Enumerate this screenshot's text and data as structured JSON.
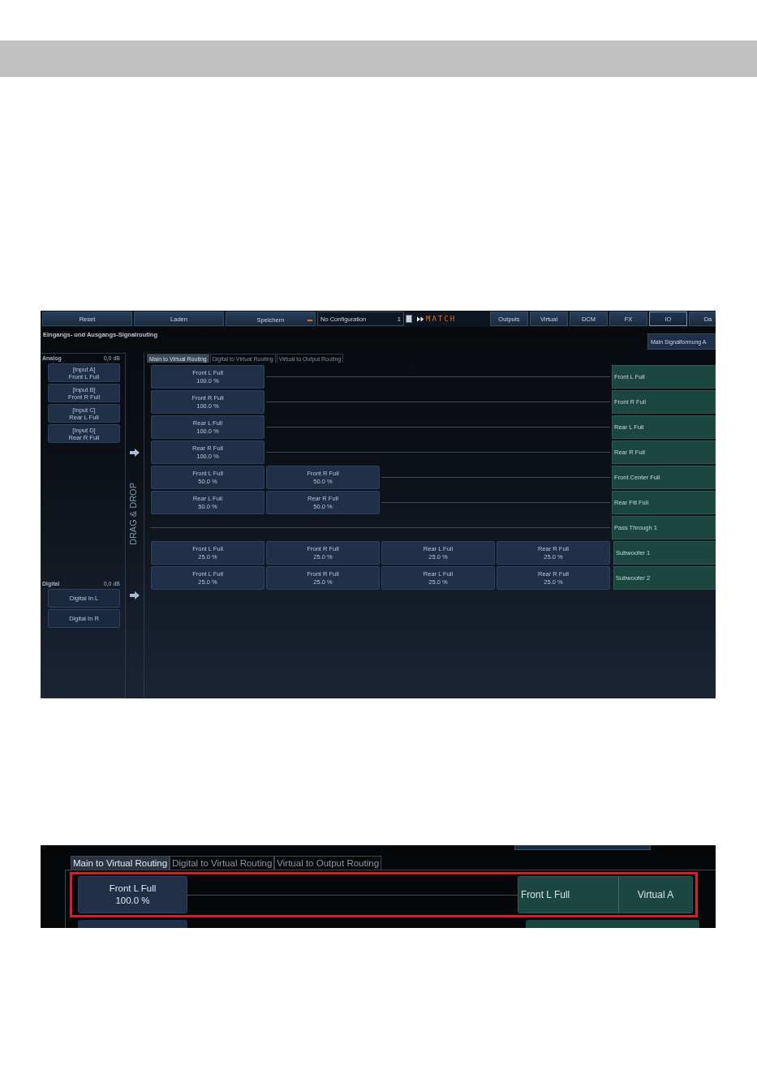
{
  "toolbar": {
    "buttons": [
      {
        "label": "Reset"
      },
      {
        "label": "Laden"
      }
    ],
    "save_dropdown": "Speichern",
    "configuration": "No Configuration",
    "configuration_index": "1",
    "logo": "MATCH",
    "nav_tabs": [
      {
        "label": "Outputs",
        "selected": false
      },
      {
        "label": "Virtual",
        "selected": false
      },
      {
        "label": "DCM",
        "selected": false
      },
      {
        "label": "FX",
        "selected": false
      },
      {
        "label": "IO",
        "selected": true
      },
      {
        "label": "Da",
        "selected": false
      }
    ]
  },
  "title": "Eingangs- und Ausgangs-Signalrouting",
  "side_button": "Main Signalformung A",
  "analog": {
    "title": "Analog",
    "gain": "0,0 dB",
    "inputs": [
      {
        "label": "[Input A]",
        "source": "Front L Full"
      },
      {
        "label": "[Input B]",
        "source": "Front R Full"
      },
      {
        "label": "[Input C]",
        "source": "Rear L Full"
      },
      {
        "label": "[Input D]",
        "source": "Rear R Full"
      }
    ]
  },
  "digital": {
    "title": "Digital",
    "gain": "0,0 dB",
    "inputs": [
      {
        "label": "Digital In L"
      },
      {
        "label": "Digital In R"
      }
    ]
  },
  "drag_hint": "DRAG & DROP",
  "routing_tabs": [
    {
      "label": "Main to Virtual Routing",
      "selected": true
    },
    {
      "label": "Digital to Virtual Routing",
      "selected": false
    },
    {
      "label": "Virtual to Output Routing",
      "selected": false
    }
  ],
  "routes": [
    {
      "sources": [
        {
          "name": "Front L Full",
          "share": "100.0 %"
        }
      ],
      "target": "Front L Full"
    },
    {
      "sources": [
        {
          "name": "Front R Full",
          "share": "100.0 %"
        }
      ],
      "target": "Front R Full"
    },
    {
      "sources": [
        {
          "name": "Rear L Full",
          "share": "100.0 %"
        }
      ],
      "target": "Rear L Full"
    },
    {
      "sources": [
        {
          "name": "Rear R Full",
          "share": "100.0 %"
        }
      ],
      "target": "Rear R Full"
    },
    {
      "sources": [
        {
          "name": "Front L Full",
          "share": "50.0 %"
        },
        {
          "name": "Front R Full",
          "share": "50.0 %"
        }
      ],
      "target": "Front Center Full"
    },
    {
      "sources": [
        {
          "name": "Rear L Full",
          "share": "50.0 %"
        },
        {
          "name": "Rear R Full",
          "share": "50.0 %"
        }
      ],
      "target": "Rear Fill Full"
    },
    {
      "target": "Pass Through 1"
    },
    {
      "sources": [
        {
          "name": "Front L Full",
          "share": "25.0 %"
        },
        {
          "name": "Front R Full",
          "share": "25.0 %"
        },
        {
          "name": "Rear L Full",
          "share": "25.0 %"
        },
        {
          "name": "Rear R Full",
          "share": "25.0 %"
        }
      ],
      "target": "Subwoofer 1"
    },
    {
      "sources": [
        {
          "name": "Front L Full",
          "share": "25.0 %"
        },
        {
          "name": "Front R Full",
          "share": "25.0 %"
        },
        {
          "name": "Rear L Full",
          "share": "25.0 %"
        },
        {
          "name": "Rear R Full",
          "share": "25.0 %"
        }
      ],
      "target": "Subwoofer 2"
    }
  ],
  "detail": {
    "routing_tabs": [
      {
        "label": "Main to Virtual Routing",
        "selected": true
      },
      {
        "label": "Digital to Virtual Routing",
        "selected": false
      },
      {
        "label": "Virtual to Output Routing",
        "selected": false
      }
    ],
    "route": {
      "source": {
        "name": "Front L Full",
        "share": "100.0 %"
      },
      "target": "Front L Full",
      "virtual": "Virtual A"
    }
  }
}
